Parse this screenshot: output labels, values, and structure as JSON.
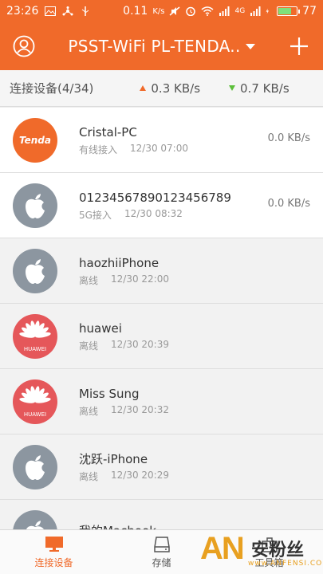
{
  "status_bar": {
    "time": "23:26",
    "net_speed": "0.11",
    "net_speed_unit": "K/s",
    "signal_label": "4G",
    "battery": "77",
    "battery_level": 0.77
  },
  "header": {
    "title": "PSST-WiFi PL-TENDA..",
    "accent": "#f06a2a"
  },
  "infobar": {
    "label": "连接设备(4/34)",
    "upload": "0.3  KB/s",
    "download": "0.7  KB/s"
  },
  "devices": [
    {
      "name": "Cristal-PC",
      "conn": "有线接入",
      "time": "12/30 07:00",
      "speed": "0.0  KB/s",
      "icon": "tenda-logo",
      "brand": "Tenda",
      "online": true
    },
    {
      "name": "01234567890123456789",
      "conn": "5G接入",
      "time": "12/30 08:32",
      "speed": "0.0  KB/s",
      "icon": "apple-icon",
      "online": true
    },
    {
      "name": "haozhiiPhone",
      "conn": "离线",
      "time": "12/30 22:00",
      "speed": "",
      "icon": "apple-icon",
      "online": false
    },
    {
      "name": "huawei",
      "conn": "离线",
      "time": "12/30 20:39",
      "speed": "",
      "icon": "huawei-logo",
      "brand": "HUAWEI",
      "online": false
    },
    {
      "name": "Miss Sung",
      "conn": "离线",
      "time": "12/30 20:32",
      "speed": "",
      "icon": "huawei-logo",
      "brand": "HUAWEI",
      "online": false
    },
    {
      "name": "沈跃-iPhone",
      "conn": "离线",
      "time": "12/30 20:29",
      "speed": "",
      "icon": "apple-icon",
      "online": false
    },
    {
      "name": "我的Macbook",
      "conn": "",
      "time": "",
      "speed": "",
      "icon": "apple-icon",
      "online": false
    }
  ],
  "tabs": [
    {
      "label": "连接设备",
      "icon": "monitor-icon",
      "active": true
    },
    {
      "label": "存储",
      "icon": "storage-icon",
      "active": false
    },
    {
      "label": "工具箱",
      "icon": "toolbox-icon",
      "active": false
    }
  ],
  "watermark": {
    "brand": "AN",
    "cn": "安粉丝",
    "url": "www.ANFENSI.COM"
  }
}
